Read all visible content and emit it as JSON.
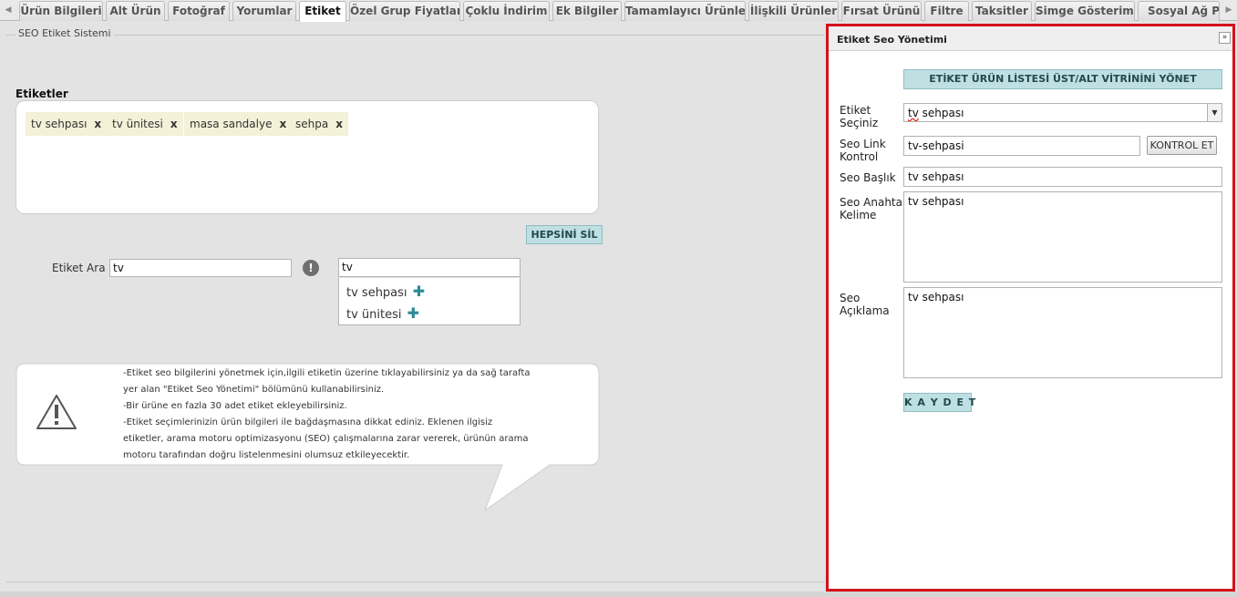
{
  "tabs": [
    {
      "label": "Ürün Bilgileri",
      "active": false
    },
    {
      "label": "Alt Ürün",
      "active": false
    },
    {
      "label": "Fotoğraf",
      "active": false
    },
    {
      "label": "Yorumlar",
      "active": false
    },
    {
      "label": "Etiket",
      "active": true
    },
    {
      "label": "Özel Grup Fiyatları",
      "active": false
    },
    {
      "label": "Çoklu İndirim",
      "active": false
    },
    {
      "label": "Ek Bilgiler",
      "active": false
    },
    {
      "label": "Tamamlayıcı Ürünler",
      "active": false
    },
    {
      "label": "İlişkili Ürünler",
      "active": false
    },
    {
      "label": "Fırsat Ürünü",
      "active": false
    },
    {
      "label": "Filtre",
      "active": false
    },
    {
      "label": "Taksitler",
      "active": false
    },
    {
      "label": "Simge Gösterimi",
      "active": false
    },
    {
      "label": "Sosyal Ağ Payla",
      "active": false
    }
  ],
  "left": {
    "legend": "SEO Etiket Sistemi",
    "tags_label": "Etiketler",
    "tags": [
      "tv sehpası",
      "tv ünitesi",
      "masa sandalye",
      "sehpa"
    ],
    "tag_remove": "x",
    "clear_all_button": "HEPSİNİ SİL",
    "search_label": "Etiket Ara",
    "search_value": "tv",
    "info_glyph": "!",
    "suggest_input_value": "tv",
    "suggestions": [
      "tv sehpası",
      "tv ünitesi"
    ],
    "info_lines": [
      "-Etiket seo bilgilerini yönetmek için,ilgili etiketin üzerine tıklayabilirsiniz ya da sağ tarafta",
      "yer alan \"Etiket Seo Yönetimi\" bölümünü kullanabilirsiniz.",
      "-Bir ürüne en fazla 30 adet etiket ekleyebilirsiniz.",
      "-Etiket seçimlerinizin ürün bilgileri ile bağdaşmasına dikkat ediniz. Eklenen ilgisiz",
      "etiketler, arama motoru optimizasyonu (SEO) çalışmalarına zarar vererek, ürünün arama",
      "motoru tarafından doğru listelenmesini olumsuz etkileyecektir."
    ]
  },
  "right": {
    "title": "Etiket Seo Yönetimi",
    "collapse_glyph": "»",
    "manage_button": "ETİKET ÜRÜN LİSTESİ ÜST/ALT VİTRİNİNİ YÖNET",
    "select_label_1": "Etiket",
    "select_label_2": "Seçiniz",
    "select_value_a": "tv",
    "select_value_b": " sehpası",
    "link_label_1": "Seo Link",
    "link_label_2": "Kontrol",
    "link_value": "tv-sehpasi",
    "check_button": "KONTROL ET",
    "title_label": "Seo Başlık",
    "title_value": "tv sehpası",
    "keywords_label_1": "Seo Anahtar",
    "keywords_label_2": "Kelime",
    "keywords_value": "tv sehpası",
    "desc_label_1": "Seo",
    "desc_label_2": "Açıklama",
    "desc_value": "tv sehpası",
    "save_button": "K A Y D E T"
  },
  "colors": {
    "highlight_border": "#d4111a",
    "tag_bg": "#f3f1d8",
    "teal_button": "#bfe0e3"
  }
}
